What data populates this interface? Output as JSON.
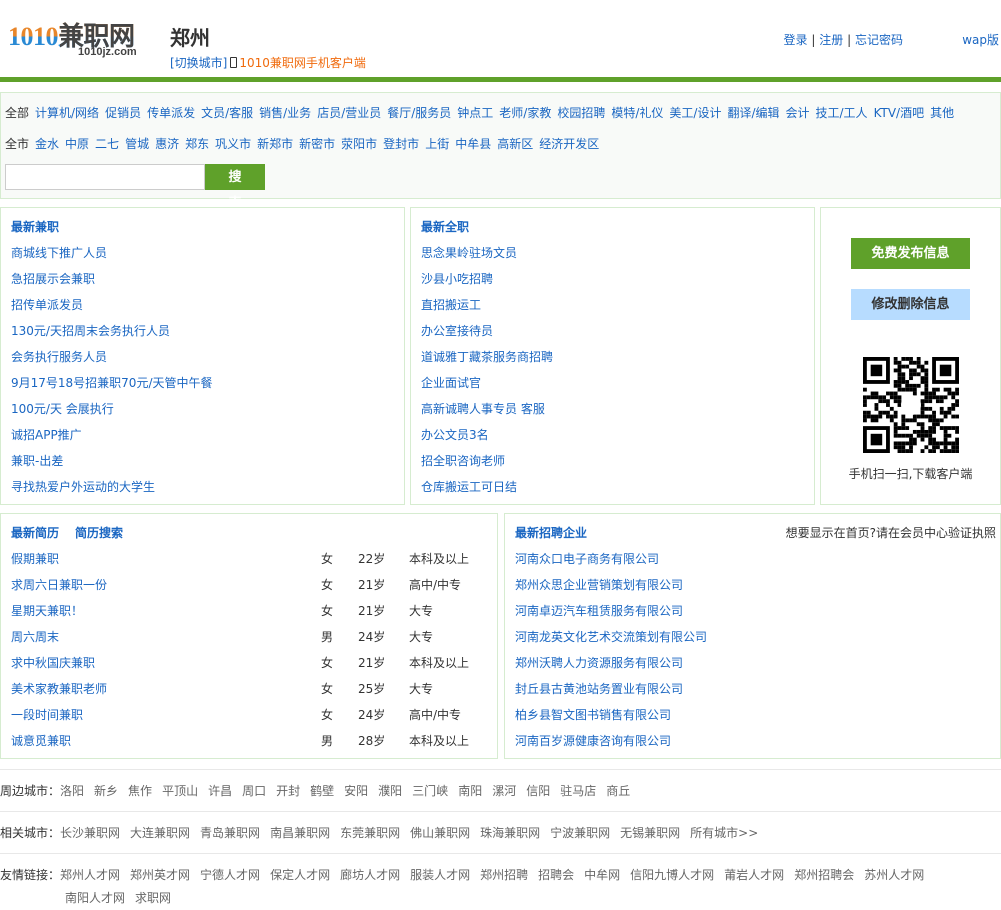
{
  "header": {
    "logo_text": "1010兼职网",
    "logo_domain": "1010jz.com",
    "city": "郑州",
    "switch_city": "[切换城市]",
    "app_link": "1010兼职网手机客户端",
    "login": "登录",
    "register": "注册",
    "forgot": "忘记密码",
    "sep": "|",
    "wap": "wap版"
  },
  "nav": {
    "category_label": "全部",
    "categories": [
      "计算机/网络",
      "促销员",
      "传单派发",
      "文员/客服",
      "销售/业务",
      "店员/营业员",
      "餐厅/服务员",
      "钟点工",
      "老师/家教",
      "校园招聘",
      "模特/礼仪",
      "美工/设计",
      "翻译/编辑",
      "会计",
      "技工/工人",
      "KTV/酒吧",
      "其他"
    ],
    "area_label": "全市",
    "areas": [
      "金水",
      "中原",
      "二七",
      "管城",
      "惠济",
      "郑东",
      "巩义市",
      "新郑市",
      "新密市",
      "荥阳市",
      "登封市",
      "上街",
      "中牟县",
      "高新区",
      "经济开发区"
    ],
    "search_value": "",
    "search_button": "搜 索"
  },
  "parttime": {
    "title": "最新兼职",
    "items": [
      "商城线下推广人员",
      "急招展示会兼职",
      "招传单派发员",
      "130元/天招周末会务执行人员",
      "会务执行服务人员",
      "9月17号18号招兼职70元/天管中午餐",
      "100元/天 会展执行",
      "诚招APP推广",
      "兼职-出差",
      "寻找热爱户外运动的大学生"
    ]
  },
  "fulltime": {
    "title": "最新全职",
    "items": [
      "思念果岭驻场文员",
      "沙县小吃招聘",
      "直招搬运工",
      "办公室接待员",
      "道诚雅丁藏茶服务商招聘",
      "企业面试官",
      "高新诚聘人事专员 客服",
      "办公文员3名",
      "招全职咨询老师",
      "仓库搬运工可日结"
    ]
  },
  "side": {
    "publish": "免费发布信息",
    "edit": "修改删除信息",
    "qr_caption": "手机扫一扫,下载客户端"
  },
  "resumes": {
    "title": "最新简历",
    "search": "简历搜索",
    "rows": [
      [
        "假期兼职",
        "女",
        "22岁",
        "本科及以上"
      ],
      [
        "求周六日兼职一份",
        "女",
        "21岁",
        "高中/中专"
      ],
      [
        "星期天兼职！",
        "女",
        "21岁",
        "大专"
      ],
      [
        "周六周末",
        "男",
        "24岁",
        "大专"
      ],
      [
        "求中秋国庆兼职",
        "女",
        "21岁",
        "本科及以上"
      ],
      [
        "美术家教兼职老师",
        "女",
        "25岁",
        "大专"
      ],
      [
        "一段时间兼职",
        "女",
        "24岁",
        "高中/中专"
      ],
      [
        "诚意觅兼职",
        "男",
        "28岁",
        "本科及以上"
      ]
    ]
  },
  "companies": {
    "title": "最新招聘企业",
    "tip": "想要显示在首页?请在会员中心验证执照",
    "items": [
      "河南众口电子商务有限公司",
      "郑州众思企业营销策划有限公司",
      "河南卓迈汽车租赁服务有限公司",
      "河南龙英文化艺术交流策划有限公司",
      "郑州沃聘人力资源服务有限公司",
      "封丘县古黄池站务置业有限公司",
      "柏乡县智文图书销售有限公司",
      "河南百岁源健康咨询有限公司"
    ]
  },
  "footer": {
    "nearby_label": "周边城市：",
    "nearby": [
      "洛阳",
      "新乡",
      "焦作",
      "平顶山",
      "许昌",
      "周口",
      "开封",
      "鹤壁",
      "安阳",
      "濮阳",
      "三门峡",
      "南阳",
      "漯河",
      "信阳",
      "驻马店",
      "商丘"
    ],
    "related_label": "相关城市：",
    "related": [
      "长沙兼职网",
      "大连兼职网",
      "青岛兼职网",
      "南昌兼职网",
      "东莞兼职网",
      "佛山兼职网",
      "珠海兼职网",
      "宁波兼职网",
      "无锡兼职网",
      "所有城市>>"
    ],
    "friends_label": "友情链接：",
    "friends": [
      "郑州人才网",
      "郑州英才网",
      "宁德人才网",
      "保定人才网",
      "廊坊人才网",
      "服装人才网",
      "郑州招聘",
      "招聘会",
      "中牟网",
      "信阳九博人才网",
      "莆岩人才网",
      "郑州招聘会",
      "苏州人才网"
    ],
    "friends2": [
      "南阳人才网",
      "求职网"
    ]
  },
  "colors": {
    "green": "#5fa12a",
    "link": "#1a66c2",
    "light_blue": "#b7dcff",
    "orange": "#f06a0c"
  }
}
